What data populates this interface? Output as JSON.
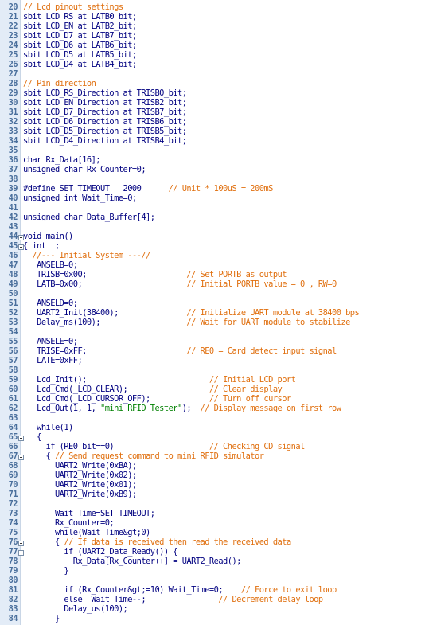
{
  "editor": {
    "lines": [
      {
        "n": "20",
        "segs": [
          [
            "cm",
            "// Lcd pinout settings"
          ]
        ]
      },
      {
        "n": "21",
        "segs": [
          [
            "plain",
            "sbit LCD_RS at LATB0_bit;"
          ]
        ]
      },
      {
        "n": "22",
        "segs": [
          [
            "plain",
            "sbit LCD_EN at LATB2_bit;"
          ]
        ]
      },
      {
        "n": "23",
        "segs": [
          [
            "plain",
            "sbit LCD_D7 at LATB7_bit;"
          ]
        ]
      },
      {
        "n": "24",
        "segs": [
          [
            "plain",
            "sbit LCD_D6 at LATB6_bit;"
          ]
        ]
      },
      {
        "n": "25",
        "segs": [
          [
            "plain",
            "sbit LCD_D5 at LATB5_bit;"
          ]
        ]
      },
      {
        "n": "26",
        "segs": [
          [
            "plain",
            "sbit LCD_D4 at LATB4_bit;"
          ]
        ]
      },
      {
        "n": "27",
        "segs": []
      },
      {
        "n": "28",
        "segs": [
          [
            "cm",
            "// Pin direction"
          ]
        ]
      },
      {
        "n": "29",
        "segs": [
          [
            "plain",
            "sbit LCD_RS_Direction at TRISB0_bit;"
          ]
        ]
      },
      {
        "n": "30",
        "segs": [
          [
            "plain",
            "sbit LCD_EN_Direction at TRISB2_bit;"
          ]
        ]
      },
      {
        "n": "31",
        "segs": [
          [
            "plain",
            "sbit LCD_D7_Direction at TRISB7_bit;"
          ]
        ]
      },
      {
        "n": "32",
        "segs": [
          [
            "plain",
            "sbit LCD_D6_Direction at TRISB6_bit;"
          ]
        ]
      },
      {
        "n": "33",
        "segs": [
          [
            "plain",
            "sbit LCD_D5_Direction at TRISB5_bit;"
          ]
        ]
      },
      {
        "n": "34",
        "segs": [
          [
            "plain",
            "sbit LCD_D4_Direction at TRISB4_bit;"
          ]
        ]
      },
      {
        "n": "35",
        "segs": []
      },
      {
        "n": "36",
        "segs": [
          [
            "plain",
            "char Rx_Data[16];"
          ]
        ]
      },
      {
        "n": "37",
        "segs": [
          [
            "plain",
            "unsigned char Rx_Counter=0;"
          ]
        ]
      },
      {
        "n": "38",
        "segs": []
      },
      {
        "n": "39",
        "segs": [
          [
            "plain",
            "#define SET_TIMEOUT   2000      "
          ],
          [
            "cm",
            "// Unit * 100uS = 200mS"
          ]
        ]
      },
      {
        "n": "40",
        "segs": [
          [
            "plain",
            "unsigned int Wait_Time=0;"
          ]
        ]
      },
      {
        "n": "41",
        "segs": []
      },
      {
        "n": "42",
        "segs": [
          [
            "plain",
            "unsigned char Data_Buffer[4];"
          ]
        ]
      },
      {
        "n": "43",
        "segs": []
      },
      {
        "n": "44",
        "segs": [
          [
            "plain",
            "void main()"
          ]
        ]
      },
      {
        "n": "45",
        "segs": [
          [
            "plain",
            "{ int i;"
          ]
        ]
      },
      {
        "n": "46",
        "segs": [
          [
            "plain",
            "  "
          ],
          [
            "cm",
            "//--- Initial System ---//"
          ]
        ]
      },
      {
        "n": "47",
        "segs": [
          [
            "plain",
            "   ANSELB=0;"
          ]
        ]
      },
      {
        "n": "48",
        "segs": [
          [
            "plain",
            "   TRISB=0x00;                      "
          ],
          [
            "cm",
            "// Set PORTB as output"
          ]
        ]
      },
      {
        "n": "49",
        "segs": [
          [
            "plain",
            "   LATB=0x00;                       "
          ],
          [
            "cm",
            "// Initial PORTB value = 0 , RW=0"
          ]
        ]
      },
      {
        "n": "50",
        "segs": []
      },
      {
        "n": "51",
        "segs": [
          [
            "plain",
            "   ANSELD=0;"
          ]
        ]
      },
      {
        "n": "52",
        "segs": [
          [
            "plain",
            "   UART2_Init(38400);               "
          ],
          [
            "cm",
            "// Initialize UART module at 38400 bps"
          ]
        ]
      },
      {
        "n": "53",
        "segs": [
          [
            "plain",
            "   Delay_ms(100);                   "
          ],
          [
            "cm",
            "// Wait for UART module to stabilize"
          ]
        ]
      },
      {
        "n": "54",
        "segs": []
      },
      {
        "n": "55",
        "segs": [
          [
            "plain",
            "   ANSELE=0;"
          ]
        ]
      },
      {
        "n": "56",
        "segs": [
          [
            "plain",
            "   TRISE=0xFF;                      "
          ],
          [
            "cm",
            "// RE0 = Card detect input signal"
          ]
        ]
      },
      {
        "n": "57",
        "segs": [
          [
            "plain",
            "   LATE=0xFF;"
          ]
        ]
      },
      {
        "n": "58",
        "segs": []
      },
      {
        "n": "59",
        "segs": [
          [
            "plain",
            "   Lcd_Init();                           "
          ],
          [
            "cm",
            "// Initial LCD port"
          ]
        ]
      },
      {
        "n": "60",
        "segs": [
          [
            "plain",
            "   Lcd_Cmd(_LCD_CLEAR);                  "
          ],
          [
            "cm",
            "// Clear display"
          ]
        ]
      },
      {
        "n": "61",
        "segs": [
          [
            "plain",
            "   Lcd_Cmd(_LCD_CURSOR_OFF);             "
          ],
          [
            "cm",
            "// Turn off cursor"
          ]
        ]
      },
      {
        "n": "62",
        "segs": [
          [
            "plain",
            "   Lcd_Out(1, 1, "
          ],
          [
            "str",
            "\"mini RFID Tester\""
          ],
          [
            "plain",
            ");  "
          ],
          [
            "cm",
            "// Display message on first row"
          ]
        ]
      },
      {
        "n": "63",
        "segs": []
      },
      {
        "n": "64",
        "segs": [
          [
            "plain",
            "   while(1)"
          ]
        ]
      },
      {
        "n": "65",
        "segs": [
          [
            "plain",
            "   {"
          ]
        ]
      },
      {
        "n": "66",
        "segs": [
          [
            "plain",
            "     if (RE0_bit==0)                     "
          ],
          [
            "cm",
            "// Checking CD signal"
          ]
        ]
      },
      {
        "n": "67",
        "segs": [
          [
            "plain",
            "     { "
          ],
          [
            "cm",
            "// Send request command to mini RFID simulator"
          ]
        ]
      },
      {
        "n": "68",
        "segs": [
          [
            "plain",
            "       UART2_Write(0xBA);"
          ]
        ]
      },
      {
        "n": "69",
        "segs": [
          [
            "plain",
            "       UART2_Write(0x02);"
          ]
        ]
      },
      {
        "n": "70",
        "segs": [
          [
            "plain",
            "       UART2_Write(0x01);"
          ]
        ]
      },
      {
        "n": "71",
        "segs": [
          [
            "plain",
            "       UART2_Write(0xB9);"
          ]
        ]
      },
      {
        "n": "72",
        "segs": []
      },
      {
        "n": "73",
        "segs": [
          [
            "plain",
            "       Wait_Time=SET_TIMEOUT;"
          ]
        ]
      },
      {
        "n": "74",
        "segs": [
          [
            "plain",
            "       Rx_Counter=0;"
          ]
        ]
      },
      {
        "n": "75",
        "segs": [
          [
            "plain",
            "       while(Wait_Time&gt;0)"
          ]
        ]
      },
      {
        "n": "76",
        "segs": [
          [
            "plain",
            "       { "
          ],
          [
            "cm",
            "// If data is received then read the received data"
          ]
        ]
      },
      {
        "n": "77",
        "segs": [
          [
            "plain",
            "         if (UART2_Data_Ready()) {"
          ]
        ]
      },
      {
        "n": "78",
        "segs": [
          [
            "plain",
            "           Rx_Data[Rx_Counter++] = UART2_Read();"
          ]
        ]
      },
      {
        "n": "79",
        "segs": [
          [
            "plain",
            "         }"
          ]
        ]
      },
      {
        "n": "80",
        "segs": []
      },
      {
        "n": "81",
        "segs": [
          [
            "plain",
            "         if (Rx_Counter&gt;=10) Wait_Time=0;    "
          ],
          [
            "cm",
            "// Force to exit loop"
          ]
        ]
      },
      {
        "n": "82",
        "segs": [
          [
            "plain",
            "         else  Wait_Time--;                "
          ],
          [
            "cm",
            "// Decrement delay loop"
          ]
        ]
      },
      {
        "n": "83",
        "segs": [
          [
            "plain",
            "         Delay_us(100);"
          ]
        ]
      },
      {
        "n": "84",
        "segs": [
          [
            "plain",
            "       }"
          ]
        ]
      }
    ],
    "fold_markers": [
      "44",
      "45",
      "65",
      "67",
      "76",
      "77"
    ],
    "colors": {
      "code": "#000080",
      "comment": "#e07010",
      "string": "#008000",
      "line_number": "#4a6f9c",
      "gutter": "#e3ecf7"
    }
  }
}
